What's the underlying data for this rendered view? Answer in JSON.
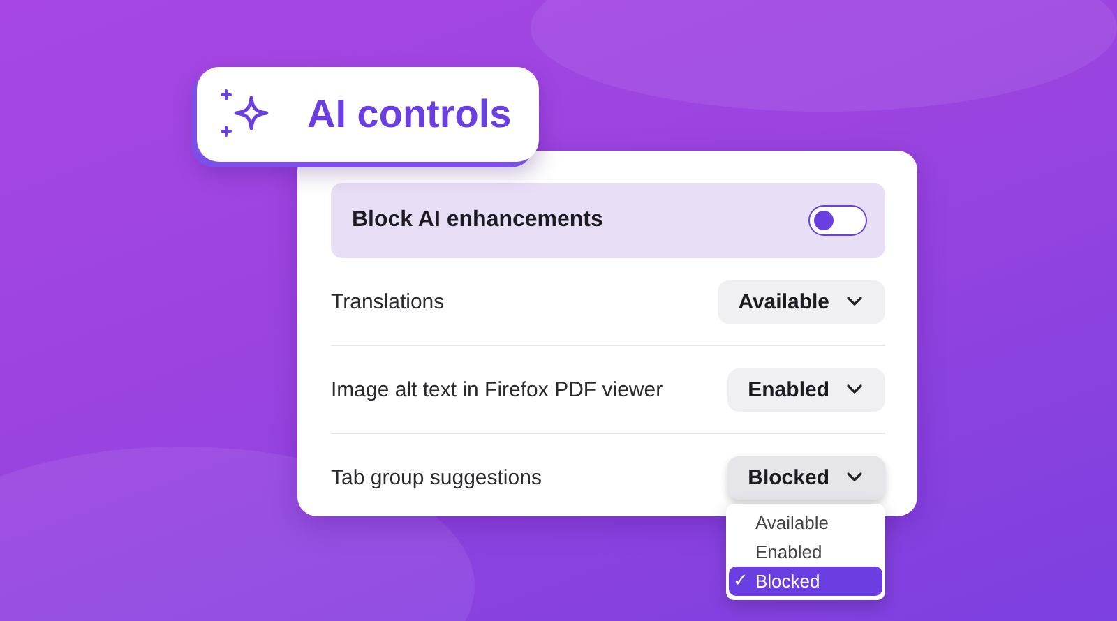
{
  "header": {
    "title": "AI controls"
  },
  "master_toggle": {
    "label": "Block AI enhancements",
    "on": false
  },
  "settings": [
    {
      "label": "Translations",
      "value": "Available",
      "expanded": false
    },
    {
      "label": "Image alt text in Firefox PDF viewer",
      "value": "Enabled",
      "expanded": false
    },
    {
      "label": "Tab group suggestions",
      "value": "Blocked",
      "expanded": true
    }
  ],
  "dropdown_menu": {
    "check_mark": "✓",
    "items": [
      {
        "label": "Available",
        "selected": false
      },
      {
        "label": "Enabled",
        "selected": false
      },
      {
        "label": "Blocked",
        "selected": true
      }
    ]
  }
}
